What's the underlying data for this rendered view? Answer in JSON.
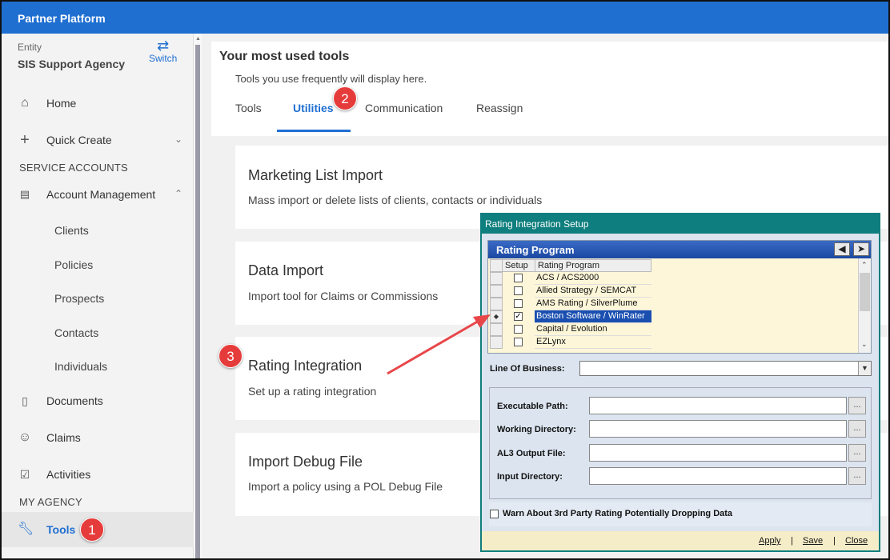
{
  "app": {
    "title": "Partner Platform"
  },
  "entity": {
    "label": "Entity",
    "name": "SIS Support Agency",
    "switch_label": "Switch"
  },
  "sidebar": {
    "home": "Home",
    "quick_create": "Quick Create",
    "service_accounts_heading": "SERVICE ACCOUNTS",
    "account_management": "Account Management",
    "sub_items": [
      "Clients",
      "Policies",
      "Prospects",
      "Contacts",
      "Individuals"
    ],
    "documents": "Documents",
    "claims": "Claims",
    "activities": "Activities",
    "my_agency_heading": "MY AGENCY",
    "tools": "Tools"
  },
  "tools_header": {
    "title": "Your most used tools",
    "subtitle": "Tools you use frequently will display here.",
    "tabs": [
      "Tools",
      "Utilities",
      "Communication",
      "Reassign"
    ],
    "active_tab": "Utilities"
  },
  "cards": [
    {
      "title": "Marketing List Import",
      "desc": "Mass import or delete lists of clients, contacts or individuals"
    },
    {
      "title": "Data Import",
      "desc": "Import tool for Claims or Commissions"
    },
    {
      "title": "Rating Integration",
      "desc": "Set up a rating integration"
    },
    {
      "title": "Import Debug File",
      "desc": "Import a policy using a POL Debug File"
    }
  ],
  "badges": [
    "1",
    "2",
    "3"
  ],
  "dialog": {
    "title": "Rating Integration Setup",
    "panel_title": "Rating Program",
    "col_setup": "Setup",
    "col_program": "Rating Program",
    "rows": [
      {
        "name": "ACS / ACS2000",
        "checked": ""
      },
      {
        "name": "Allied Strategy / SEMCAT",
        "checked": ""
      },
      {
        "name": "AMS Rating / SilverPlume",
        "checked": ""
      },
      {
        "name": "Boston Software / WinRater",
        "checked": "✓"
      },
      {
        "name": "Capital / Evolution",
        "checked": ""
      },
      {
        "name": "EZLynx",
        "checked": ""
      }
    ],
    "selected_row_marker": "◆",
    "lob_label": "Line Of Business:",
    "lob_value": "",
    "fields": [
      {
        "label": "Executable Path:",
        "value": ""
      },
      {
        "label": "Working Directory:",
        "value": ""
      },
      {
        "label": "AL3 Output File:",
        "value": ""
      },
      {
        "label": "Input Directory:",
        "value": ""
      }
    ],
    "browse_label": "...",
    "warn_label": "Warn About 3rd Party Rating Potentially Dropping Data",
    "apply": "Apply",
    "save": "Save",
    "close": "Close",
    "separator": "|"
  },
  "colors": {
    "brand": "#1f6fd1",
    "dialog_border": "#0f7e7e",
    "badge": "#e63b3b",
    "selected_row": "#1a4fb0"
  }
}
